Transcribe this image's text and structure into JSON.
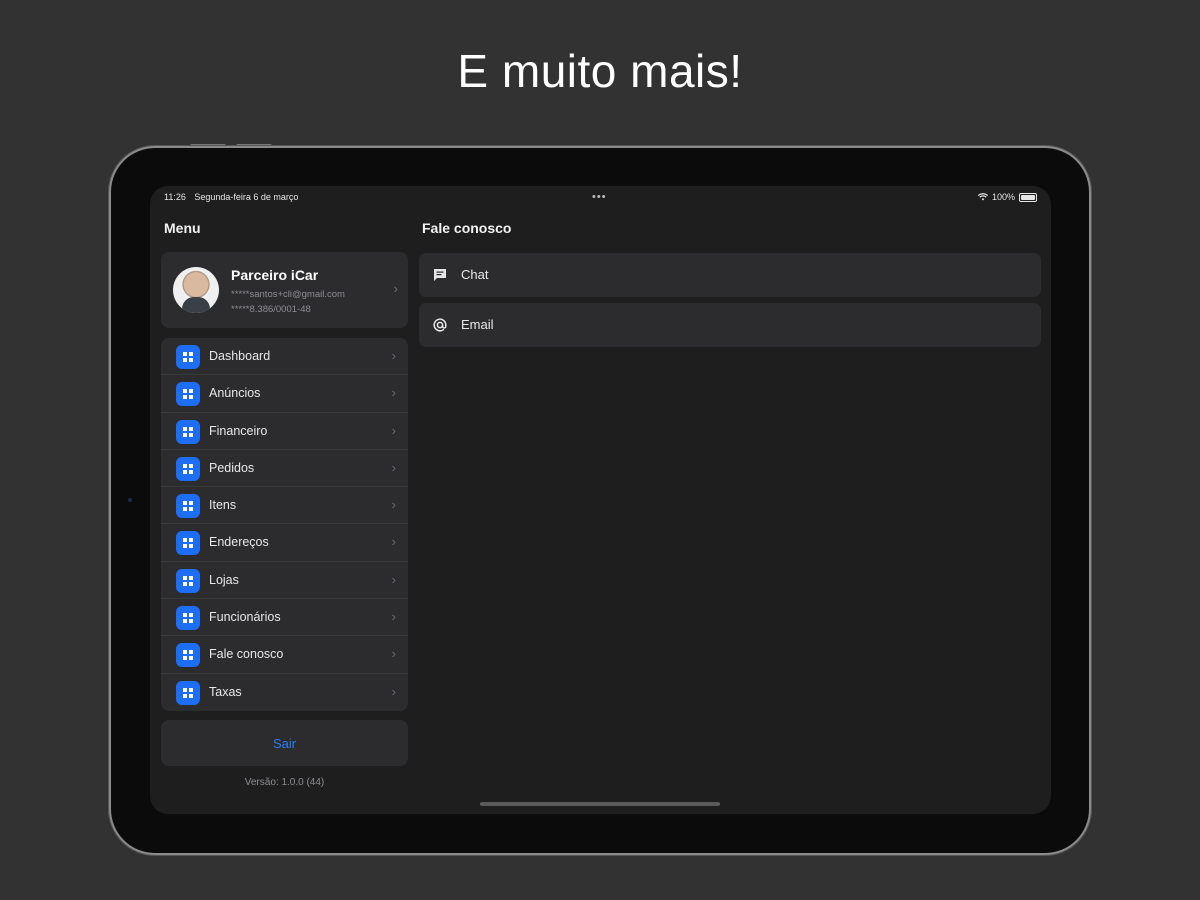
{
  "headline": "E muito mais!",
  "statusbar": {
    "time": "11:26",
    "date": "Segunda-feira 6 de março",
    "dots": "•••",
    "battery_percent": "100%"
  },
  "sidebar": {
    "title": "Menu",
    "profile": {
      "name": "Parceiro iCar",
      "email": "*****santos+cli@gmail.com",
      "document": "*****8.386/0001-48"
    },
    "items": [
      {
        "label": "Dashboard"
      },
      {
        "label": "Anúncios"
      },
      {
        "label": "Financeiro"
      },
      {
        "label": "Pedidos"
      },
      {
        "label": "Itens"
      },
      {
        "label": "Endereços"
      },
      {
        "label": "Lojas"
      },
      {
        "label": "Funcionários"
      },
      {
        "label": "Fale conosco"
      },
      {
        "label": "Taxas"
      }
    ],
    "logout_label": "Sair",
    "version": "Versão: 1.0.0 (44)"
  },
  "detail": {
    "title": "Fale conosco",
    "items": [
      {
        "label": "Chat",
        "icon": "chat-bubble-icon"
      },
      {
        "label": "Email",
        "icon": "at-sign-icon"
      }
    ]
  },
  "colors": {
    "background": "#323232",
    "screen": "#1e1e1e",
    "card": "#2c2c2e",
    "accent": "#1e6df5",
    "link": "#2a7cf6"
  }
}
